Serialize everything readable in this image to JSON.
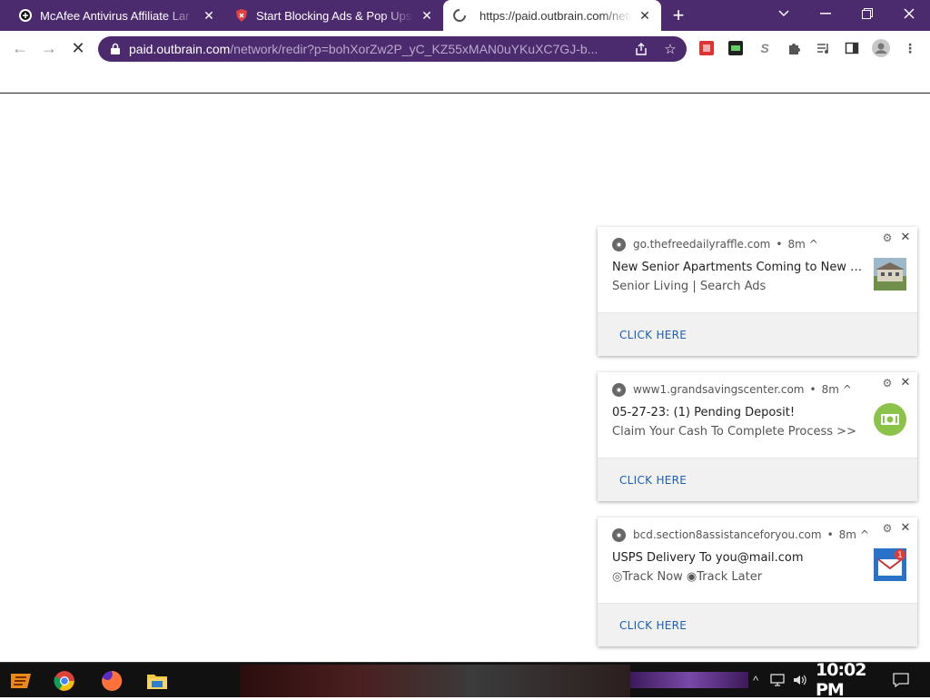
{
  "tabs": [
    {
      "title": "McAfee Antivirus Affiliate Lar",
      "favicon": "mcafee-icon"
    },
    {
      "title": "Start Blocking Ads & Pop Ups F",
      "favicon": "shield-icon"
    },
    {
      "title": "https://paid.outbrain.com/netw",
      "favicon": "loading-spinner-icon",
      "active": true
    }
  ],
  "omnibox": {
    "host": "paid.outbrain.com",
    "path": "/network/redir?p=bohXorZw2P_yC_KZ55xMAN0uYKuXC7GJ-b..."
  },
  "notifications": [
    {
      "source": "go.thefreedailyraffle.com",
      "age": "8m",
      "title": "New Senior Apartments Coming to New York...",
      "message": "Senior Living | Search Ads",
      "action": "CLICK HERE",
      "thumb": "apartment-photo"
    },
    {
      "source": "www1.grandsavingscenter.com",
      "age": "8m",
      "title": "05-27-23: (1) Pending Deposit!",
      "message": " Claim Your Cash To Complete Process >>",
      "action": "CLICK HERE",
      "thumb": "cash-icon"
    },
    {
      "source": "bcd.section8assistanceforyou.com",
      "age": "8m",
      "title": "USPS Delivery To you@mail.com",
      "message": "◎Track Now  ◉Track Later",
      "action": "CLICK HERE",
      "thumb": "mail-badge-icon",
      "badge": "1"
    }
  ],
  "taskbar": {
    "clock": "10:02 PM"
  },
  "colors": {
    "theme": "#4b2a6e",
    "link": "#1a5fb4"
  }
}
